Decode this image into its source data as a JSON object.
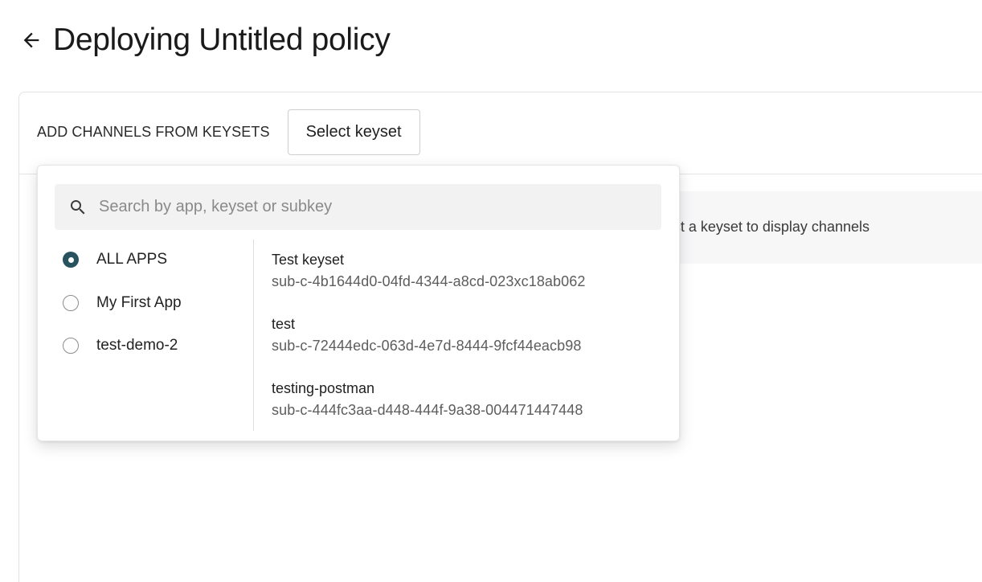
{
  "header": {
    "title": "Deploying Untitled policy"
  },
  "toolbar": {
    "label": "ADD CHANNELS FROM KEYSETS",
    "select_keyset_label": "Select keyset"
  },
  "empty_state": {
    "text": "Select a keyset to display channels"
  },
  "dropdown": {
    "search_placeholder": "Search by app, keyset or subkey",
    "apps": [
      {
        "label": "ALL APPS",
        "selected": true
      },
      {
        "label": "My First App",
        "selected": false
      },
      {
        "label": "test-demo-2",
        "selected": false
      }
    ],
    "keysets": [
      {
        "name": "Test keyset",
        "subkey": "sub-c-4b1644d0-04fd-4344-a8cd-023xc18ab062"
      },
      {
        "name": "test",
        "subkey": "sub-c-72444edc-063d-4e7d-8444-9fcf44eacb98"
      },
      {
        "name": "testing-postman",
        "subkey": "sub-c-444fc3aa-d448-444f-9a38-004471447448"
      }
    ]
  },
  "colors": {
    "radio_selected": "#29525f",
    "search_bg": "#f2f2f3",
    "banner_bg": "#f7f7f8"
  },
  "icons": {
    "back": "arrow-left-icon",
    "search": "search-icon"
  }
}
